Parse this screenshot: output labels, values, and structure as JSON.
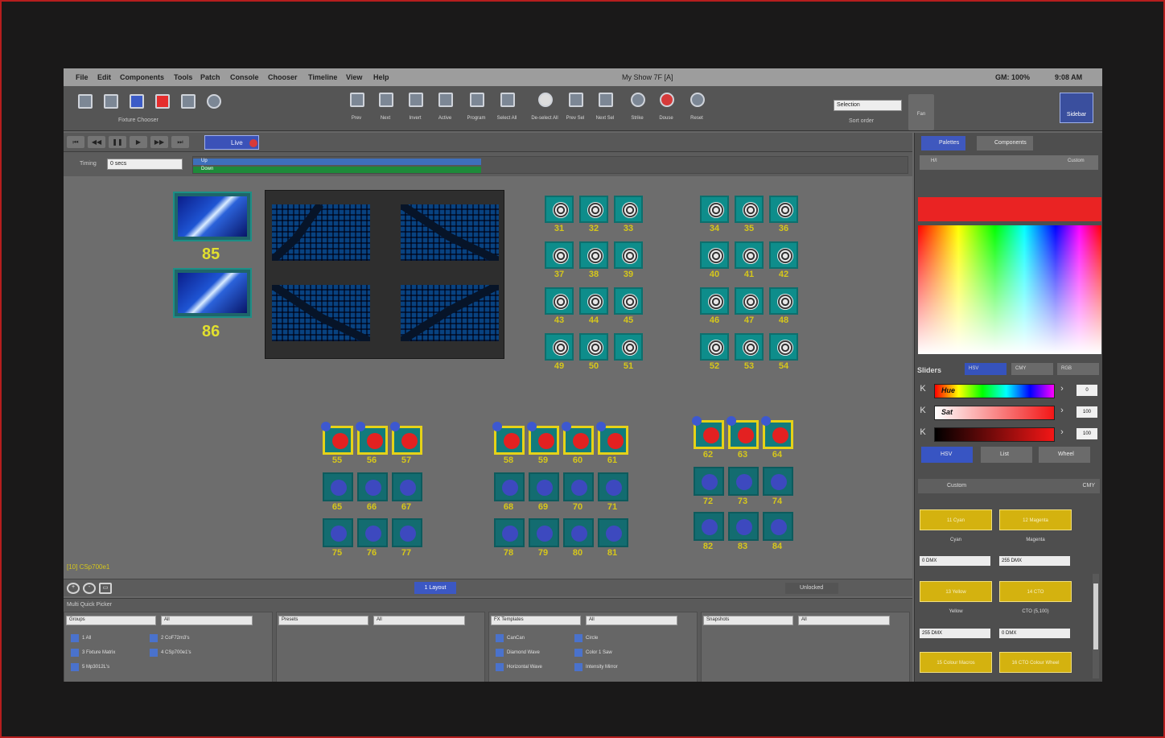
{
  "menu": [
    "File",
    "Edit",
    "Components",
    "Tools",
    "Patch",
    "Console",
    "Chooser",
    "Timeline",
    "View",
    "Help"
  ],
  "window_title": "My Show 7F [A]",
  "gm": "GM: 100%",
  "clock": "9:08 AM",
  "toolbar": {
    "fixture_chooser_label": "Fixture Chooser",
    "left_buttons": [
      {
        "name": "fixture-layout-icon"
      },
      {
        "name": "fixture-list-icon"
      },
      {
        "name": "selection-icon"
      },
      {
        "name": "color-icon"
      },
      {
        "name": "beam-icon"
      },
      {
        "name": "position-icon"
      }
    ],
    "buttons": [
      "Prev",
      "Next",
      "Invert",
      "Active",
      "Program",
      "Select All",
      "De-select All",
      "Prev Sel",
      "Next Sel",
      "Strike",
      "Douse",
      "Reset"
    ],
    "sort_select": "Selection",
    "sort_label": "Sort order",
    "fan_label": "Fan",
    "sidebar_label": "Sidebar"
  },
  "playback": {
    "buttons": [
      "⏮",
      "◀◀",
      "❚❚",
      "▶",
      "▶▶",
      "⏭"
    ],
    "live_tab": "Live"
  },
  "timing": {
    "label": "Timing",
    "value": "0 secs",
    "up": "Up",
    "down": "Down"
  },
  "canvas": {
    "image_fixtures": [
      "85",
      "86"
    ],
    "gobo_group_a": [
      "31",
      "32",
      "33",
      "37",
      "38",
      "39",
      "43",
      "44",
      "45",
      "49",
      "50",
      "51"
    ],
    "gobo_group_b": [
      "34",
      "35",
      "36",
      "40",
      "41",
      "42",
      "46",
      "47",
      "48",
      "52",
      "53",
      "54"
    ],
    "rgb_a_top": [
      "55",
      "56",
      "57"
    ],
    "rgb_b_top": [
      "58",
      "59",
      "60",
      "61"
    ],
    "rgb_c_top": [
      "62",
      "63",
      "64"
    ],
    "blue_a_1": [
      "65",
      "66",
      "67"
    ],
    "blue_b_1": [
      "68",
      "69",
      "70",
      "71"
    ],
    "blue_c_1": [
      "72",
      "73",
      "74"
    ],
    "blue_a_2": [
      "75",
      "76",
      "77"
    ],
    "blue_b_2": [
      "78",
      "79",
      "80",
      "81"
    ],
    "blue_c_2": [
      "82",
      "83",
      "84"
    ],
    "status": "[10] CSp700e1",
    "layout_tab": "1 Layout",
    "lock_label": "Unlocked"
  },
  "quick_picker": {
    "title": "Multi Quick Picker",
    "groups": {
      "select": "Groups",
      "filter": "All",
      "items": [
        "1 All",
        "2 CoF72m3's",
        "3 Fixture Matrix",
        "4 CSp700e1's",
        "5 Mp3012L's"
      ]
    },
    "presets": {
      "select": "Presets",
      "filter": "All"
    },
    "fx": {
      "select": "FX Templates",
      "filter": "All",
      "items": [
        "CanCan",
        "Circle",
        "Diamond Wave",
        "Color 1 Saw",
        "Horizontal Wave",
        "Intensity Mirror"
      ]
    },
    "snapshots": {
      "select": "Snapshots",
      "filter": "All"
    }
  },
  "sidebar": {
    "tabs": [
      "Palettes",
      "Components"
    ],
    "palette_buttons": [
      "H/I",
      "Custom"
    ],
    "sliders_label": "Sliders",
    "modes": [
      "HSV",
      "CMY",
      "RGB"
    ],
    "hue": {
      "label": "Hue",
      "value": "0"
    },
    "sat": {
      "label": "Sat",
      "value": "100"
    },
    "val": {
      "label": "",
      "value": "100"
    },
    "bottom_modes": [
      "HSV",
      "List",
      "Wheel"
    ],
    "custom_label": "Custom",
    "cmy_label": "CMY",
    "color_cells": [
      {
        "button": "11 Cyan",
        "name": "Cyan",
        "value": "0 DMX"
      },
      {
        "button": "12 Magenta",
        "name": "Magenta",
        "value": "255 DMX"
      },
      {
        "button": "13 Yellow",
        "name": "Yellow",
        "value": "255 DMX"
      },
      {
        "button": "14 CTO",
        "name": "CTO (5,100)",
        "value": "0 DMX"
      }
    ],
    "bottom_buttons": [
      "15 Colour Macros",
      "16 CTO Colour Wheel"
    ]
  }
}
